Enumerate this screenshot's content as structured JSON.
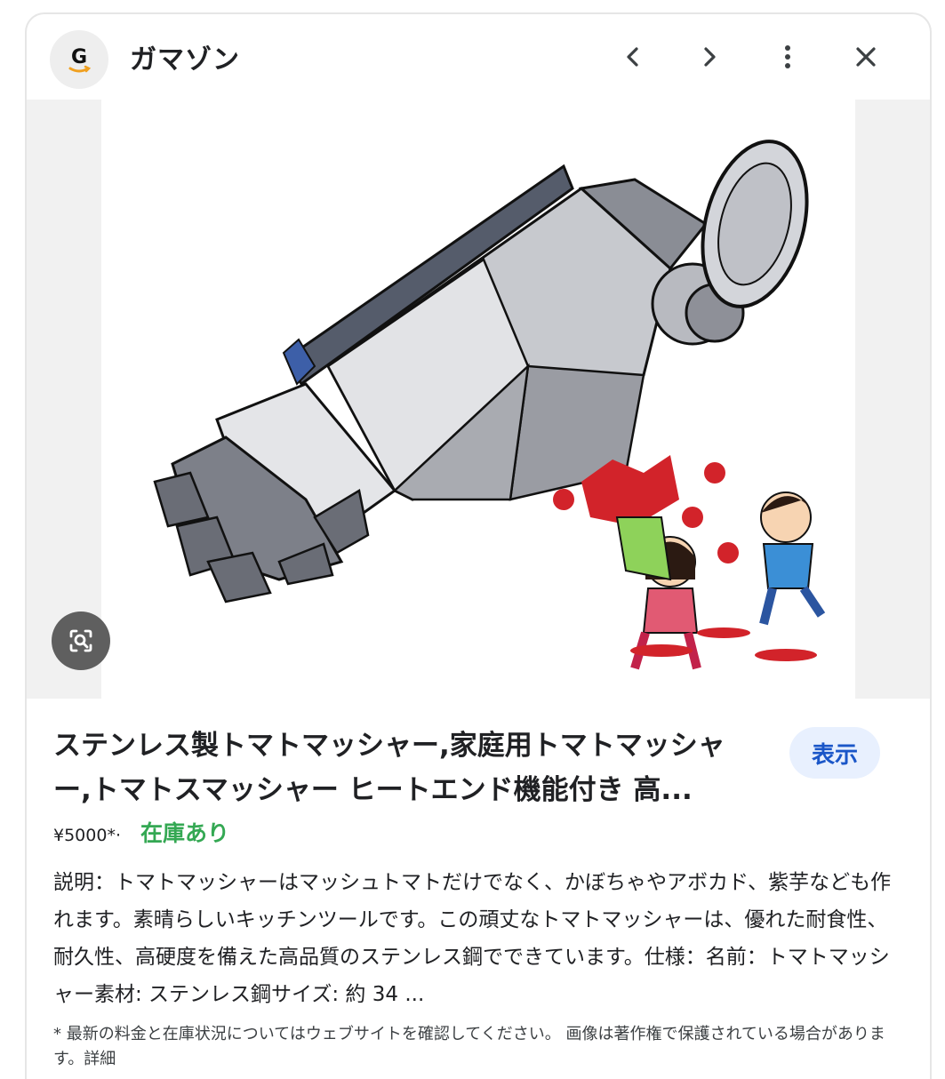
{
  "header": {
    "site_name": "ガマゾン",
    "favicon_letter": "G"
  },
  "product": {
    "title": "ステンレス製トマトマッシャー,家庭用トマトマッシャー,トマトスマッシャー ヒートエンド機能付き 高...",
    "view_label": "表示",
    "price": "¥5000*·",
    "stock": "在庫あり",
    "description_label": "説明：",
    "description": "トマトマッシャーはマッシュトマトだけでなく、かぼちゃやアボカド、紫芋なども作れます。素晴らしいキッチンツールです。この頑丈なトマトマッシャーは、優れた耐食性、耐久性、高硬度を備えた高品質のステンレス鋼でできています。仕様：名前：トマトマッシャー素材: ステンレス鋼サイズ: 約 34 ..."
  },
  "footer": {
    "note": "* 最新の料金と在庫状況についてはウェブサイトを確認してください。 画像は著作権で保護されている場合があります。",
    "details_link": "詳細"
  },
  "colors": {
    "accent_blue": "#1a56c8",
    "view_bg": "#e8f0fe",
    "stock_green": "#34a853",
    "lens_bg": "#5f5f5f"
  },
  "icons": [
    "favicon-icon",
    "back-icon",
    "forward-icon",
    "more-icon",
    "close-icon",
    "lens-icon"
  ]
}
